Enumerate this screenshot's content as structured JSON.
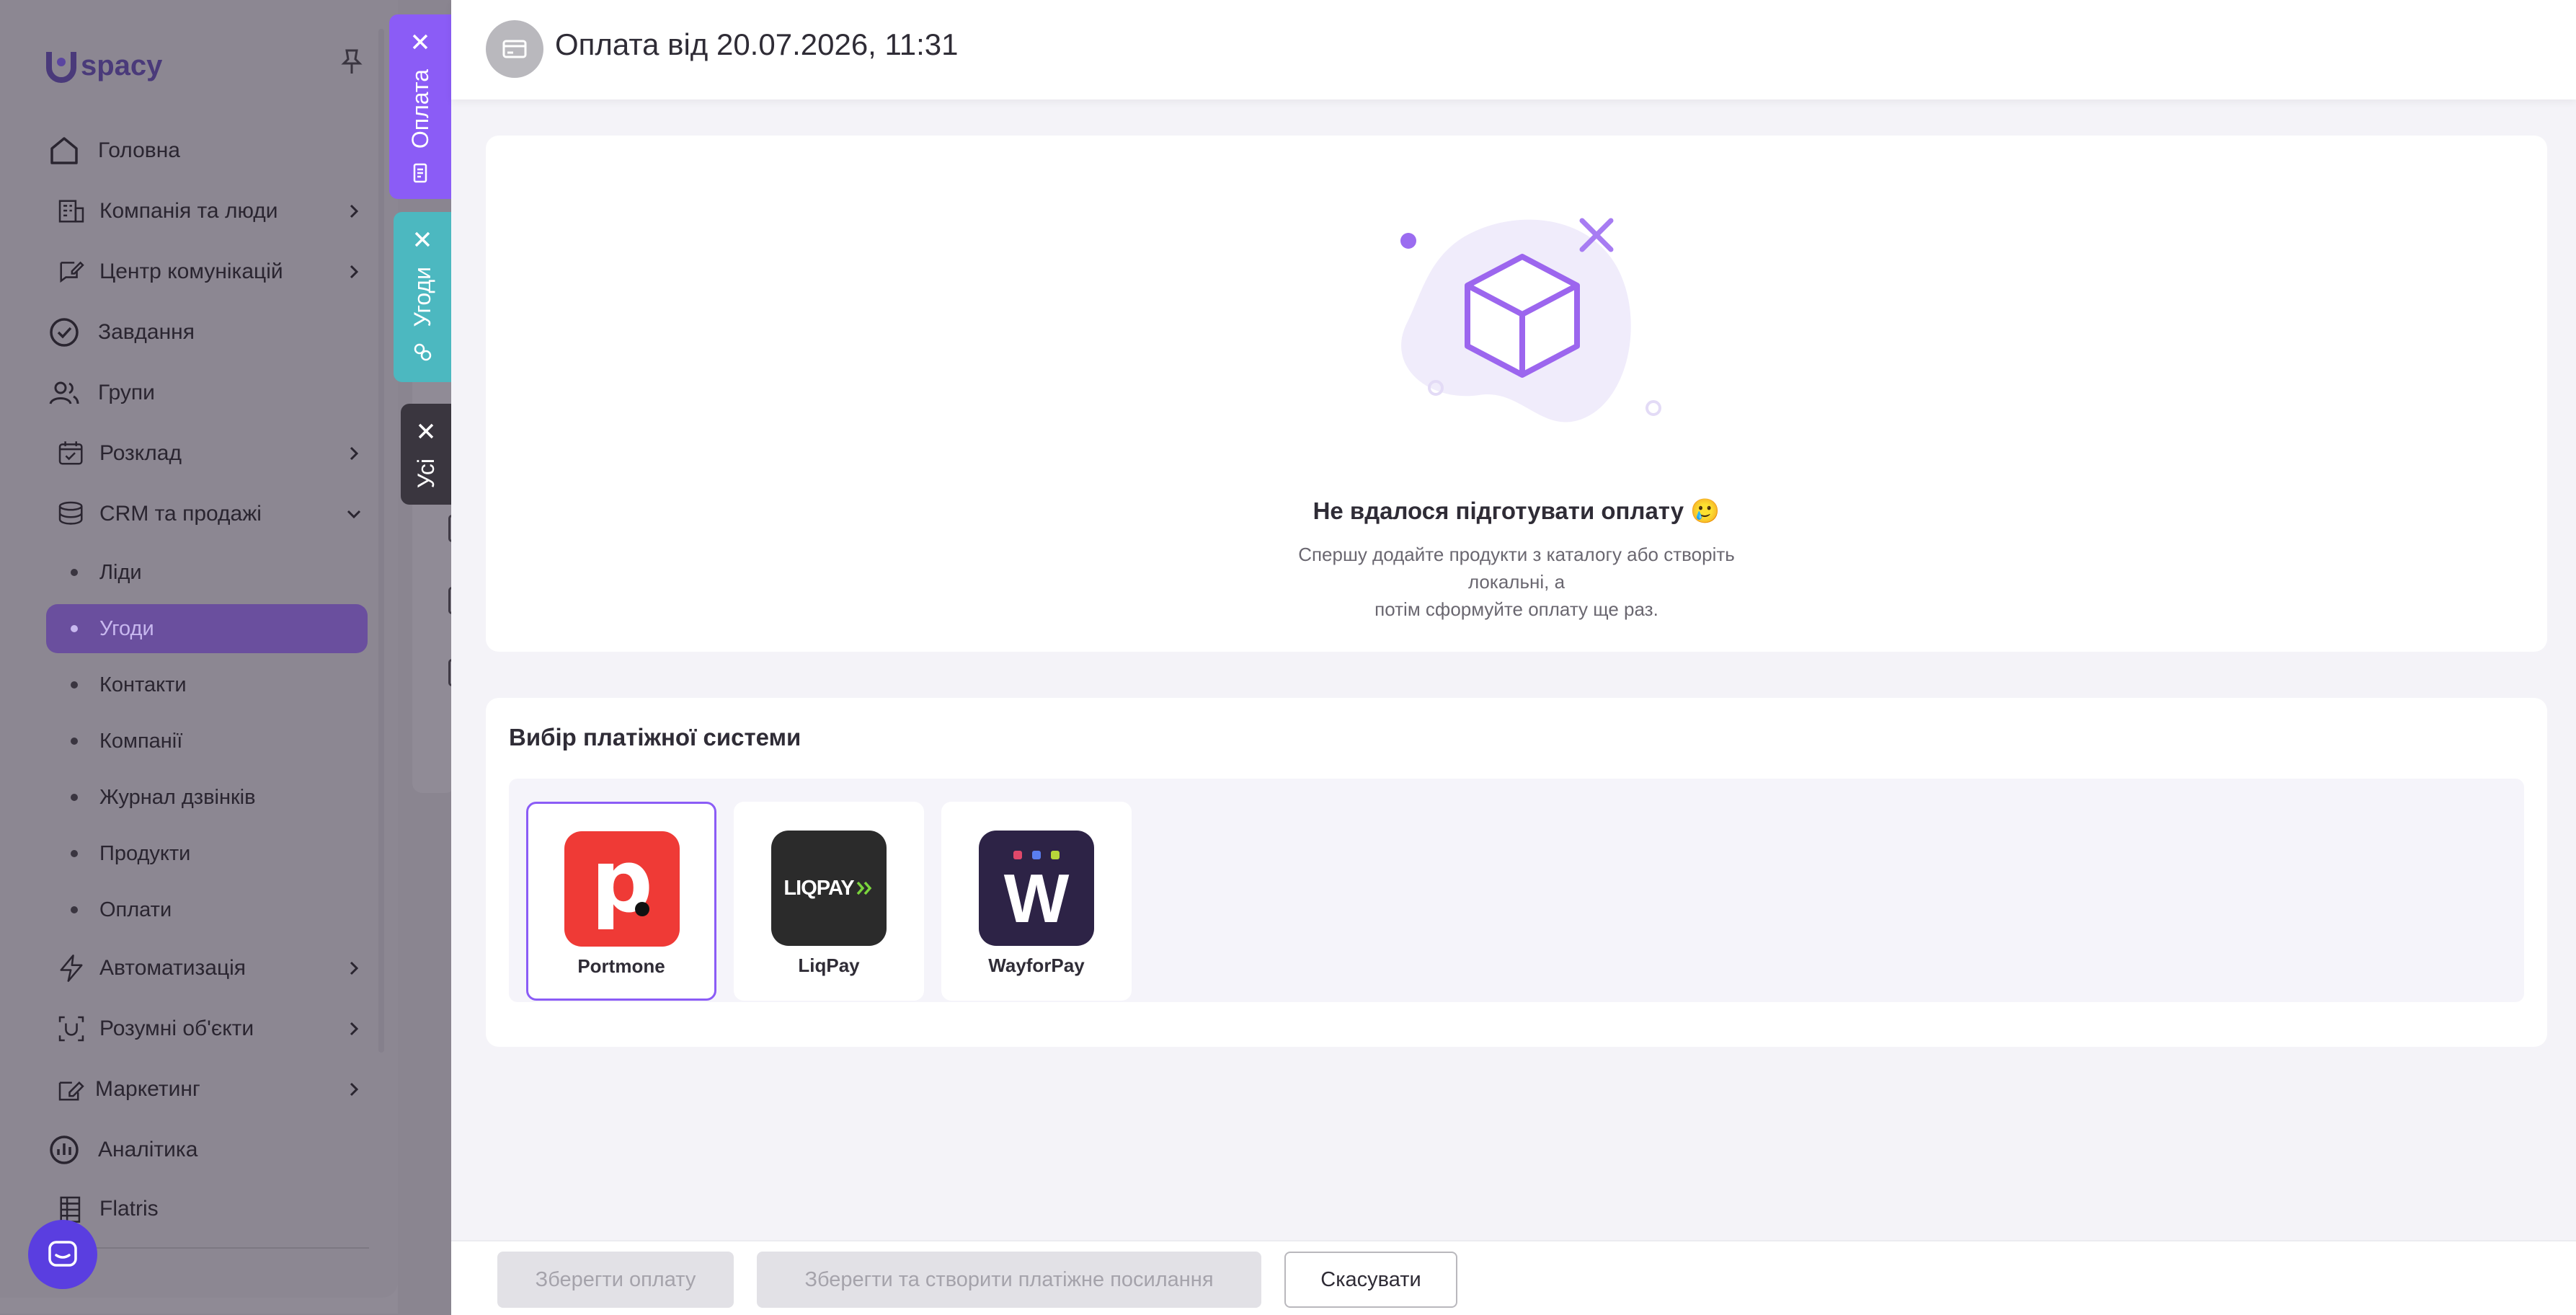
{
  "app": {
    "logo_text": "spacy"
  },
  "sidebar": {
    "items": [
      {
        "label": "Головна",
        "icon": "home-icon"
      },
      {
        "label": "Компанія та люди",
        "icon": "company-icon"
      },
      {
        "label": "Центр комунікацій",
        "icon": "chat-edit-icon"
      },
      {
        "label": "Завдання",
        "icon": "check-circle-icon"
      },
      {
        "label": "Групи",
        "icon": "users-icon"
      },
      {
        "label": "Розклад",
        "icon": "calendar-icon"
      },
      {
        "label": "CRM та продажі",
        "icon": "database-icon"
      },
      {
        "label": "Автоматизація",
        "icon": "lightning-icon"
      },
      {
        "label": "Розумні об'єкти",
        "icon": "smart-object-icon"
      },
      {
        "label": "Маркетинг",
        "icon": "marketing-icon"
      },
      {
        "label": "Аналітика",
        "icon": "analytics-icon"
      },
      {
        "label": "Flatris",
        "icon": "flatris-icon"
      }
    ],
    "crm_sub": [
      "Ліди",
      "Угоди",
      "Контакти",
      "Компанії",
      "Журнал дзвінків",
      "Продукти",
      "Оплати"
    ],
    "active_sub": "Угоди"
  },
  "tabs": [
    {
      "label": "Оплата",
      "color": "#8b5cf6"
    },
    {
      "label": "Угоди",
      "color": "#4cb8c0"
    },
    {
      "label": "Усі",
      "color": "#3a363f"
    }
  ],
  "panel": {
    "title": "Оплата від 20.07.2026, 11:31",
    "empty": {
      "title": "Не вдалося підготувати оплату 🥲",
      "desc_line1": "Спершу додайте продукти з каталогу або створіть локальні, а",
      "desc_line2": "потім сформуйте оплату ще раз."
    },
    "payment": {
      "title": "Вибір платіжної системи",
      "options": [
        {
          "name": "Portmone",
          "selected": true
        },
        {
          "name": "LiqPay",
          "selected": false
        },
        {
          "name": "WayforPay",
          "selected": false
        }
      ],
      "liqpay_logo_text": "LIQPAY",
      "portmone_logo_letter": "p",
      "wayforpay_logo_letter": "W"
    },
    "footer": {
      "save": "Зберегти оплату",
      "save_link": "Зберегти та створити платіжне посилання",
      "cancel": "Скасувати"
    }
  },
  "colors": {
    "accent": "#8b5cf6",
    "teal": "#4cb8c0",
    "portmone": "#ef3a36"
  }
}
